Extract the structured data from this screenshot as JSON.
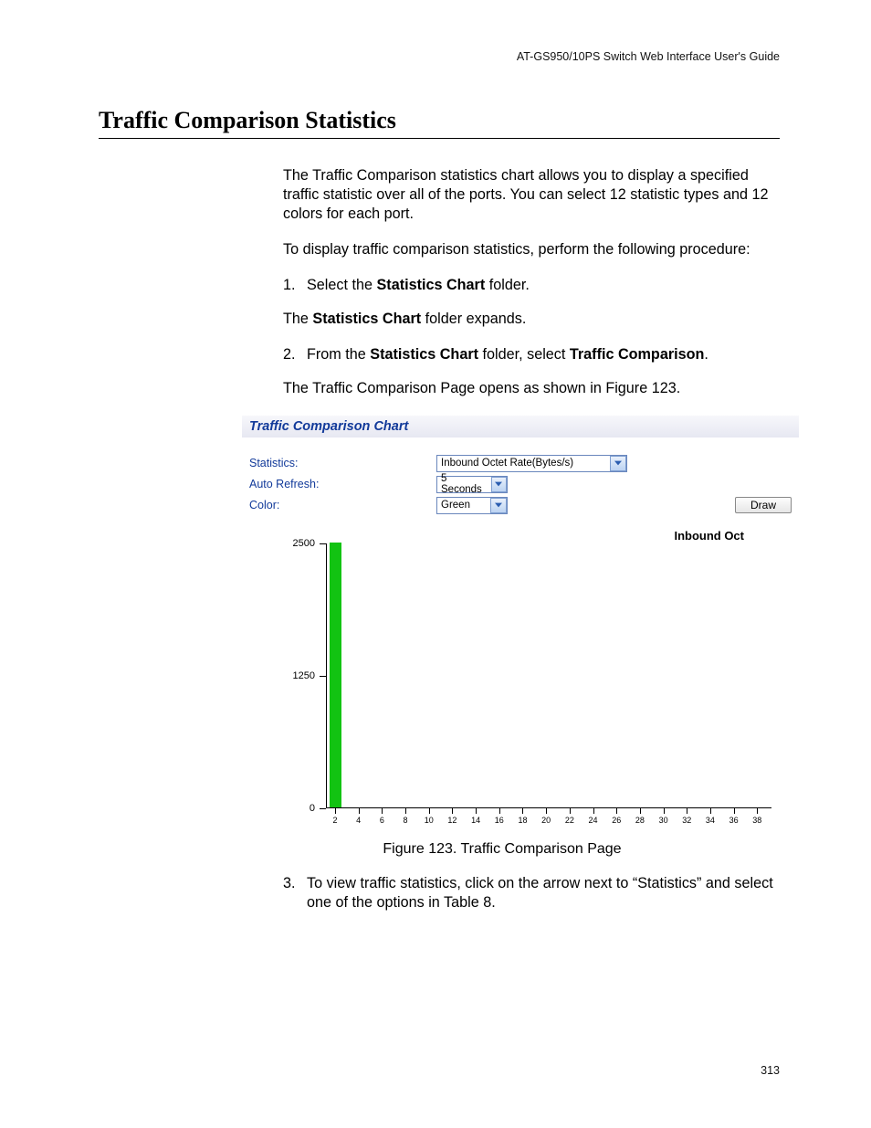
{
  "header": {
    "guide_title": "AT-GS950/10PS Switch Web Interface User's Guide"
  },
  "section": {
    "title": "Traffic Comparison Statistics"
  },
  "paragraphs": {
    "intro": "The Traffic Comparison statistics chart allows you to display a specified traffic statistic over all of the ports. You can select 12 statistic types and 12 colors for each port.",
    "proc_lead": "To display traffic comparison statistics, perform the following procedure:",
    "step1_a": "Select the ",
    "step1_b_bold": "Statistics Chart",
    "step1_c": " folder.",
    "step1_res_a": "The ",
    "step1_res_b_bold": "Statistics Chart",
    "step1_res_c": " folder expands.",
    "step2_a": "From the ",
    "step2_b_bold": "Statistics Chart",
    "step2_c": " folder, select ",
    "step2_d_bold": "Traffic Comparison",
    "step2_e": ".",
    "step2_res": "The Traffic Comparison Page opens as shown in Figure 123.",
    "step3": "To view traffic statistics, click on the arrow next to “Statistics” and select one of the options in Table 8."
  },
  "steps": {
    "n1": "1.",
    "n2": "2.",
    "n3": "3."
  },
  "figure": {
    "panel_title": "Traffic Comparison Chart",
    "labels": {
      "statistics": "Statistics:",
      "auto_refresh": "Auto Refresh:",
      "color": "Color:"
    },
    "selects": {
      "statistics_value": "Inbound Octet Rate(Bytes/s)",
      "auto_refresh_value": "5 Seconds",
      "color_value": "Green"
    },
    "draw_button": "Draw",
    "chart_top_title": "Inbound Oct",
    "caption": "Figure 123. Traffic Comparison Page"
  },
  "chart_data": {
    "type": "bar",
    "title": "Inbound Oct",
    "xlabel": "",
    "ylabel": "",
    "ylim": [
      0,
      2500
    ],
    "y_ticks": [
      0,
      1250,
      2500
    ],
    "categories": [
      "2",
      "4",
      "6",
      "8",
      "10",
      "12",
      "14",
      "16",
      "18",
      "20",
      "22",
      "24",
      "26",
      "28",
      "30",
      "32",
      "34",
      "36",
      "38"
    ],
    "values": [
      2500,
      0,
      0,
      0,
      0,
      0,
      0,
      0,
      0,
      0,
      0,
      0,
      0,
      0,
      0,
      0,
      0,
      0,
      0
    ],
    "bar_color": "#12c312"
  },
  "page_number": "313"
}
